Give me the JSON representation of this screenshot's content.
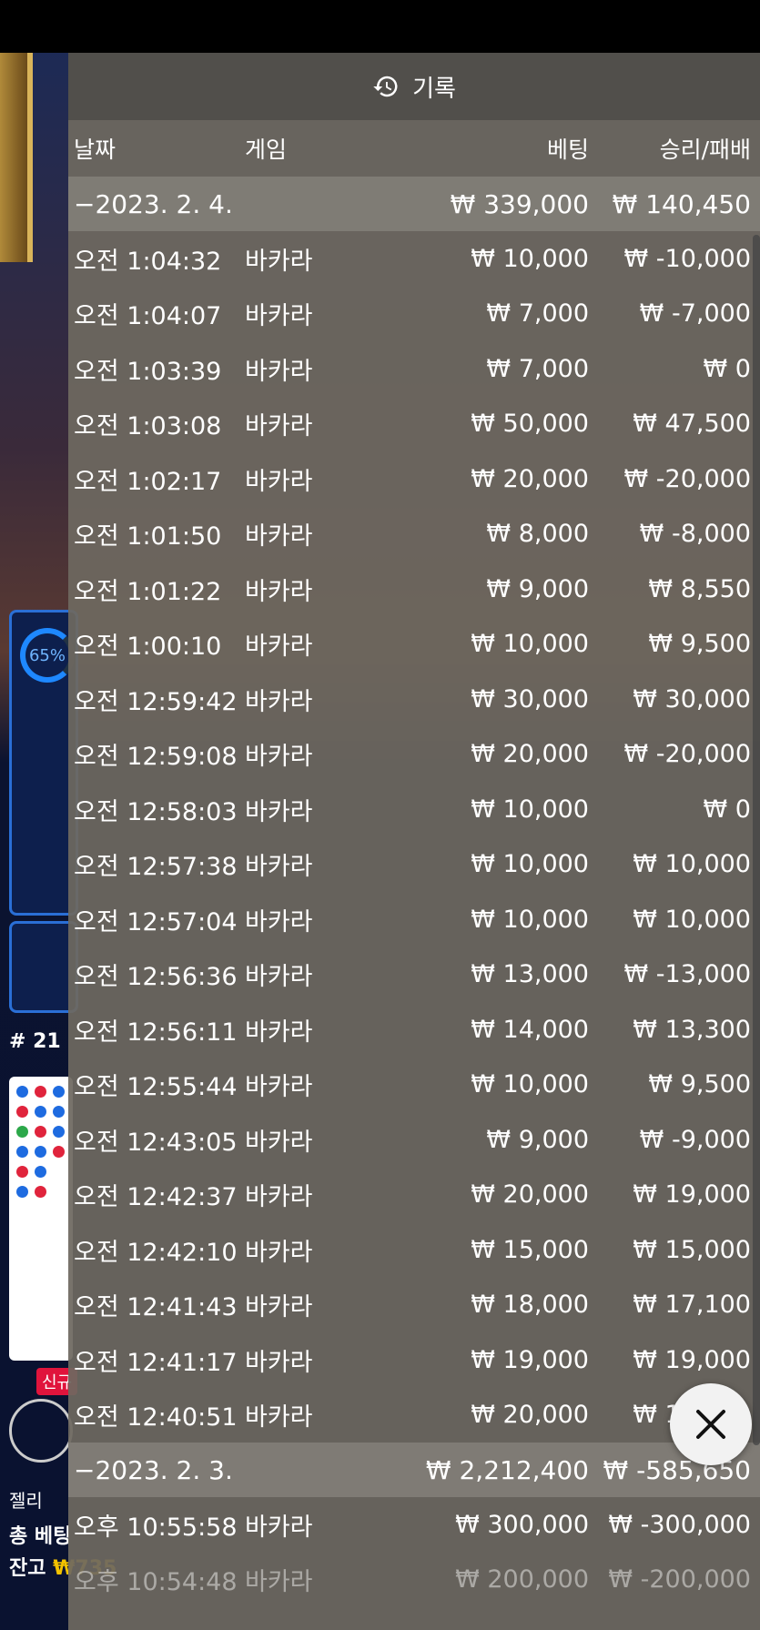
{
  "background": {
    "percent": "65%",
    "round": "# 21",
    "badge": "신규",
    "user": "젤리",
    "total_bet_label": "총 베팅",
    "balance_label": "잔고",
    "balance_value": "₩735"
  },
  "history": {
    "title": "기록",
    "columns": {
      "date": "날짜",
      "game": "게임",
      "bet": "베팅",
      "win": "승리/패배"
    },
    "groups": [
      {
        "date": "−2023. 2. 4.",
        "bet": "₩ 339,000",
        "win": "₩ 140,450",
        "rows": [
          {
            "time": "오전 1:04:32",
            "game": "바카라",
            "bet": "₩ 10,000",
            "win": "₩ -10,000"
          },
          {
            "time": "오전 1:04:07",
            "game": "바카라",
            "bet": "₩ 7,000",
            "win": "₩ -7,000"
          },
          {
            "time": "오전 1:03:39",
            "game": "바카라",
            "bet": "₩ 7,000",
            "win": "₩ 0"
          },
          {
            "time": "오전 1:03:08",
            "game": "바카라",
            "bet": "₩ 50,000",
            "win": "₩ 47,500"
          },
          {
            "time": "오전 1:02:17",
            "game": "바카라",
            "bet": "₩ 20,000",
            "win": "₩ -20,000"
          },
          {
            "time": "오전 1:01:50",
            "game": "바카라",
            "bet": "₩ 8,000",
            "win": "₩ -8,000"
          },
          {
            "time": "오전 1:01:22",
            "game": "바카라",
            "bet": "₩ 9,000",
            "win": "₩ 8,550"
          },
          {
            "time": "오전 1:00:10",
            "game": "바카라",
            "bet": "₩ 10,000",
            "win": "₩ 9,500"
          },
          {
            "time": "오전 12:59:42",
            "game": "바카라",
            "bet": "₩ 30,000",
            "win": "₩ 30,000"
          },
          {
            "time": "오전 12:59:08",
            "game": "바카라",
            "bet": "₩ 20,000",
            "win": "₩ -20,000"
          },
          {
            "time": "오전 12:58:03",
            "game": "바카라",
            "bet": "₩ 10,000",
            "win": "₩ 0"
          },
          {
            "time": "오전 12:57:38",
            "game": "바카라",
            "bet": "₩ 10,000",
            "win": "₩ 10,000"
          },
          {
            "time": "오전 12:57:04",
            "game": "바카라",
            "bet": "₩ 10,000",
            "win": "₩ 10,000"
          },
          {
            "time": "오전 12:56:36",
            "game": "바카라",
            "bet": "₩ 13,000",
            "win": "₩ -13,000"
          },
          {
            "time": "오전 12:56:11",
            "game": "바카라",
            "bet": "₩ 14,000",
            "win": "₩ 13,300"
          },
          {
            "time": "오전 12:55:44",
            "game": "바카라",
            "bet": "₩ 10,000",
            "win": "₩ 9,500"
          },
          {
            "time": "오전 12:43:05",
            "game": "바카라",
            "bet": "₩ 9,000",
            "win": "₩ -9,000"
          },
          {
            "time": "오전 12:42:37",
            "game": "바카라",
            "bet": "₩ 20,000",
            "win": "₩ 19,000"
          },
          {
            "time": "오전 12:42:10",
            "game": "바카라",
            "bet": "₩ 15,000",
            "win": "₩ 15,000"
          },
          {
            "time": "오전 12:41:43",
            "game": "바카라",
            "bet": "₩ 18,000",
            "win": "₩ 17,100"
          },
          {
            "time": "오전 12:41:17",
            "game": "바카라",
            "bet": "₩ 19,000",
            "win": "₩ 19,000"
          },
          {
            "time": "오전 12:40:51",
            "game": "바카라",
            "bet": "₩ 20,000",
            "win": "₩ 19,000"
          }
        ]
      },
      {
        "date": "−2023. 2. 3.",
        "bet": "₩ 2,212,400",
        "win": "₩ -585,650",
        "rows": [
          {
            "time": "오후 10:55:58",
            "game": "바카라",
            "bet": "₩ 300,000",
            "win": "₩ -300,000"
          },
          {
            "time": "오후 10:54:48",
            "game": "바카라",
            "bet": "₩ 200,000",
            "win": "₩ -200,000"
          }
        ]
      }
    ]
  }
}
